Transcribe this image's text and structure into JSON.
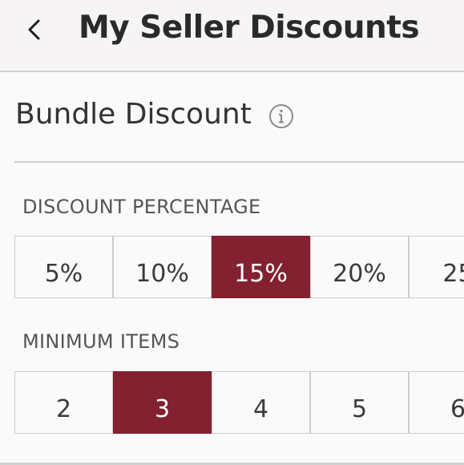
{
  "header": {
    "title": "My Seller Discounts",
    "back_icon": "chevron-left-icon"
  },
  "bundle": {
    "title": "Bundle Discount",
    "info_icon": "info-icon"
  },
  "discount_percentage": {
    "label": "DISCOUNT PERCENTAGE",
    "options": [
      "5%",
      "10%",
      "15%",
      "20%",
      "25"
    ],
    "selected": "15%"
  },
  "minimum_items": {
    "label": "MINIMUM ITEMS",
    "options": [
      "2",
      "3",
      "4",
      "5",
      "6"
    ],
    "selected": "3"
  },
  "colors": {
    "accent": "#832130",
    "header_bg": "#f6f4f4",
    "background": "#fafafa",
    "border": "#cccccc"
  }
}
